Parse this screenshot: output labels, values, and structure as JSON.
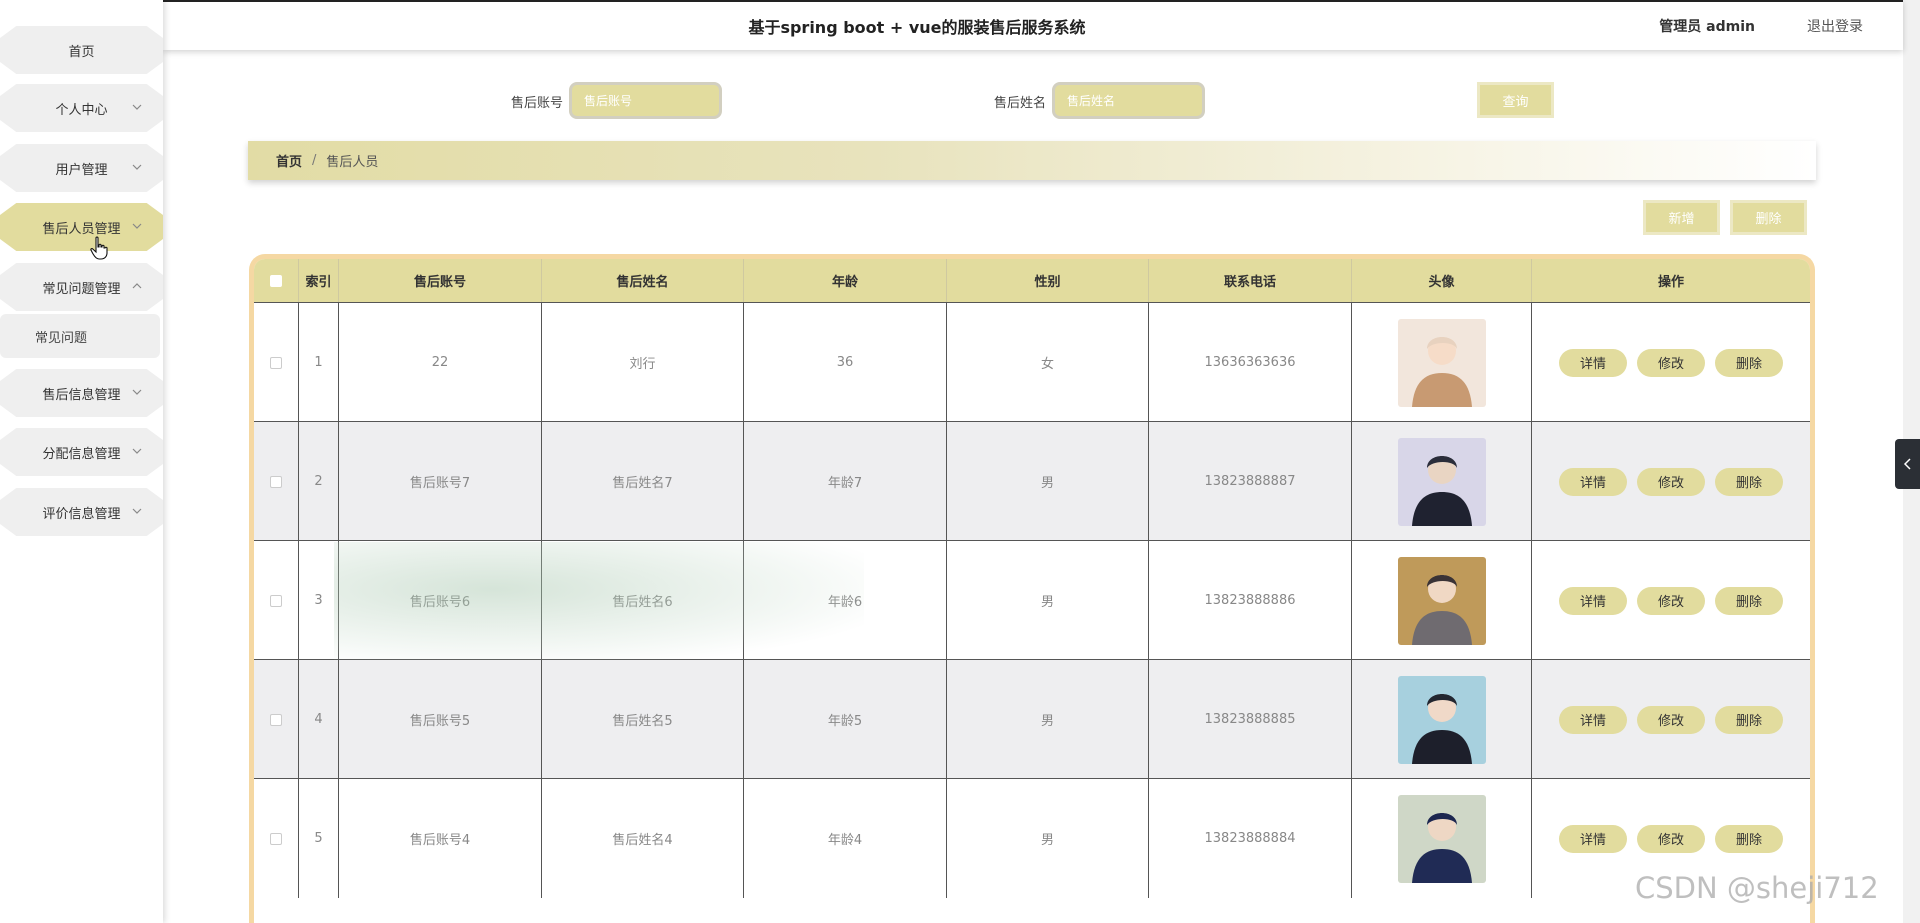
{
  "header": {
    "title": "基于spring boot + vue的服装售后服务系统",
    "user": "管理员 admin",
    "logout": "退出登录"
  },
  "sidebar": {
    "items": [
      {
        "label": "首页"
      },
      {
        "label": "个人中心"
      },
      {
        "label": "用户管理"
      },
      {
        "label": "售后人员管理"
      },
      {
        "label": "常见问题管理"
      },
      {
        "label": "常见问题"
      },
      {
        "label": "售后信息管理"
      },
      {
        "label": "分配信息管理"
      },
      {
        "label": "评价信息管理"
      }
    ]
  },
  "search": {
    "account_label": "售后账号",
    "account_placeholder": "售后账号",
    "name_label": "售后姓名",
    "name_placeholder": "售后姓名",
    "query_button": "查询"
  },
  "breadcrumb": {
    "home": "首页",
    "separator": "/",
    "current": "售后人员"
  },
  "actions": {
    "add": "新增",
    "delete": "删除"
  },
  "table": {
    "columns": [
      "索引",
      "售后账号",
      "售后姓名",
      "年龄",
      "性别",
      "联系电话",
      "头像",
      "操作"
    ],
    "op_labels": {
      "detail": "详情",
      "edit": "修改",
      "delete": "删除"
    },
    "rows": [
      {
        "index": "1",
        "account": "22",
        "name": "刘行",
        "age": "36",
        "gender": "女",
        "phone": "13636363636"
      },
      {
        "index": "2",
        "account": "售后账号7",
        "name": "售后姓名7",
        "age": "年龄7",
        "gender": "男",
        "phone": "13823888887"
      },
      {
        "index": "3",
        "account": "售后账号6",
        "name": "售后姓名6",
        "age": "年龄6",
        "gender": "男",
        "phone": "13823888886"
      },
      {
        "index": "4",
        "account": "售后账号5",
        "name": "售后姓名5",
        "age": "年龄5",
        "gender": "男",
        "phone": "13823888885"
      },
      {
        "index": "5",
        "account": "售后账号4",
        "name": "售后姓名4",
        "age": "年龄4",
        "gender": "男",
        "phone": "13823888884"
      }
    ]
  },
  "watermark": "CSDN @sheji712",
  "colors": {
    "accent": "#e2dc9e",
    "table_border": "#f5d8a3",
    "sidebar_item": "#efefef"
  }
}
